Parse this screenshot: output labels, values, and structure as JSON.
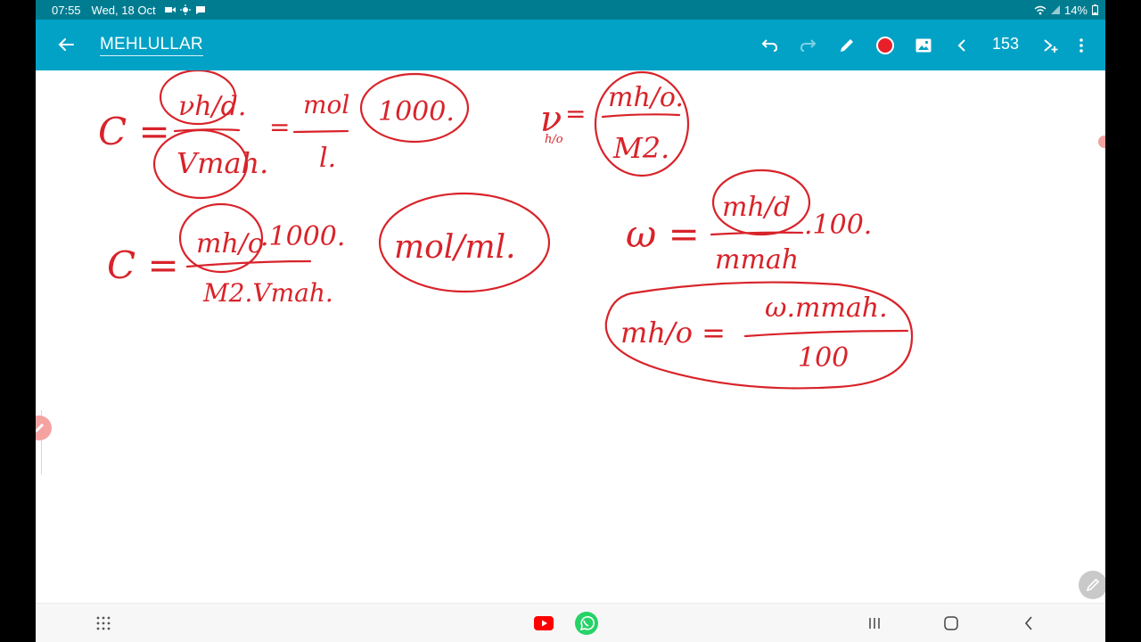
{
  "status_bar": {
    "time": "07:55",
    "date": "Wed, 18 Oct",
    "battery": "14%"
  },
  "app_bar": {
    "title": "MEHLULLAR",
    "page_number": "153",
    "pen_color": "#e8202a"
  },
  "icons": {
    "back": "arrow-left-icon",
    "undo": "undo-icon",
    "redo": "redo-icon",
    "pen": "pencil-icon",
    "image": "image-icon",
    "prev_page": "chevron-left-icon",
    "add_page": "add-page-icon",
    "more": "more-vertical-icon"
  },
  "formulas": {
    "f1_lhs": "C =",
    "f1_num": "νh/d.",
    "f1_den": "Vmah.",
    "f1_eq2": "=",
    "f1_unit_num": "mol",
    "f1_unit_den": "l.",
    "f1_factor": "1000.",
    "f2_lhs": "ν",
    "f2_lhs_sub": "h/o",
    "f2_eq": "=",
    "f2_num": "mh/o.",
    "f2_den": "M2.",
    "f3_lhs": "C =",
    "f3_num": "mh/o",
    "f3_factor": ".1000.",
    "f3_den": "M2.Vmah.",
    "f3_unit": "mol/ml.",
    "f4_lhs": "ω =",
    "f4_num": "mh/d",
    "f4_factor": ".100.",
    "f4_den": "mmah",
    "f5_lhs": "mh/o =",
    "f5_num": "ω.mmah.",
    "f5_den": "100"
  },
  "colors": {
    "status_bar": "#007c91",
    "app_bar": "#01a2c6",
    "ink": "#d8232a"
  }
}
